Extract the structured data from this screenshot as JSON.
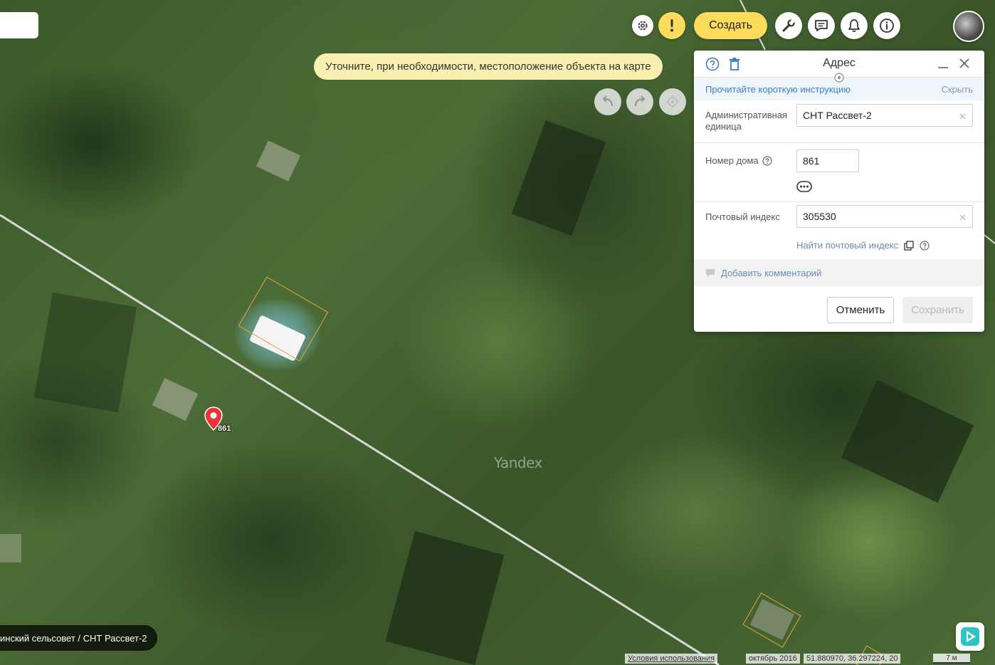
{
  "toolbar": {
    "create_label": "Создать",
    "icons": [
      "gear-icon",
      "alert-icon",
      "wrench-icon",
      "feedback-icon",
      "bell-icon",
      "info-icon"
    ]
  },
  "hint": {
    "text": "Уточните, при необходимости, местоположение объекта на карте"
  },
  "map": {
    "watermark": "Yandex",
    "pin_label": "861",
    "breadcrumb": "инский сельсовет / СНТ Рассвет-2",
    "terms_link": "Условия использования",
    "date": "октябрь 2016",
    "coords": "51.880970, 36.297224, 20",
    "scale": "7 м"
  },
  "panel": {
    "title": "Адрес",
    "instruction_link": "Прочитайте короткую инструкцию",
    "hide_link": "Скрыть",
    "admin_unit": {
      "label": "Административная единица",
      "value": "СНТ Рассвет-2"
    },
    "house_number": {
      "label": "Номер дома",
      "value": "861"
    },
    "postal_code": {
      "label": "Почтовый индекс",
      "value": "305530",
      "find_link": "Найти почтовый индекс"
    },
    "add_comment": "Добавить комментарий",
    "cancel_label": "Отменить",
    "save_label": "Сохранить"
  },
  "colors": {
    "accent_yellow": "#fddc5c",
    "hint_bg": "#f9efb1",
    "link_blue": "#3d7cc9",
    "plot_outline": "#e8a33a"
  }
}
